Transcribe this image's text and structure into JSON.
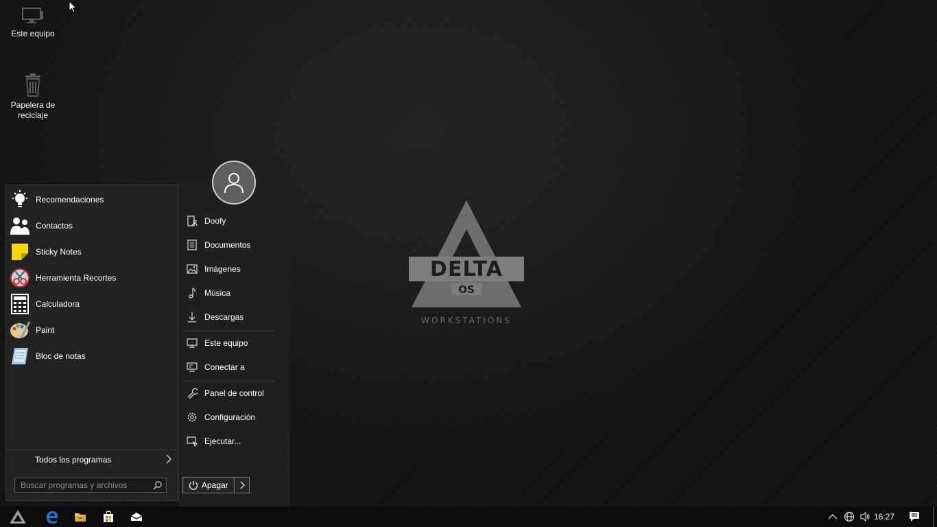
{
  "desktop": {
    "icons": [
      {
        "label": "Este equipo",
        "icon": "monitor-icon"
      },
      {
        "label": "Papelera de reciclaje",
        "icon": "recycle-bin-icon"
      }
    ],
    "wallpaper": {
      "logo_text": "DELTA OS",
      "logo_subtext": "WORKSTATIONS"
    }
  },
  "start_menu": {
    "apps": [
      {
        "label": "Recomendaciones",
        "icon": "lightbulb-icon"
      },
      {
        "label": "Contactos",
        "icon": "contacts-icon"
      },
      {
        "label": "Sticky Notes",
        "icon": "sticky-notes-icon"
      },
      {
        "label": "Herramienta Recortes",
        "icon": "snipping-tool-icon"
      },
      {
        "label": "Calculadora",
        "icon": "calculator-icon"
      },
      {
        "label": "Paint",
        "icon": "paint-palette-icon"
      },
      {
        "label": "Bloc de notas",
        "icon": "notepad-icon"
      }
    ],
    "all_programs_label": "Todos los programas",
    "search_placeholder": "Buscar programas y archivos",
    "places": [
      {
        "label": "Doofy",
        "icon": "user-folder-icon"
      },
      {
        "label": "Documentos",
        "icon": "document-icon"
      },
      {
        "label": "Imágenes",
        "icon": "image-icon"
      },
      {
        "label": "Música",
        "icon": "music-note-icon"
      },
      {
        "label": "Descargas",
        "icon": "download-icon"
      },
      {
        "label": "Este equipo",
        "icon": "computer-icon"
      },
      {
        "label": "Conectar a",
        "icon": "connect-icon"
      },
      {
        "label": "Panel de control",
        "icon": "wrench-icon"
      },
      {
        "label": "Configuración",
        "icon": "gear-icon"
      },
      {
        "label": "Ejecutar...",
        "icon": "run-icon"
      }
    ],
    "power_label": "Apagar"
  },
  "taskbar": {
    "pinned": [
      "start-logo-icon",
      "edge-browser-icon",
      "file-explorer-icon",
      "store-icon",
      "mail-icon"
    ],
    "tray": [
      "chevron-up-icon",
      "network-globe-icon",
      "volume-icon"
    ],
    "clock": "16:27"
  },
  "colors": {
    "accent_blue": "#1a78d4",
    "sticky_yellow": "#f6d80a",
    "menu_bg": "#232323"
  }
}
